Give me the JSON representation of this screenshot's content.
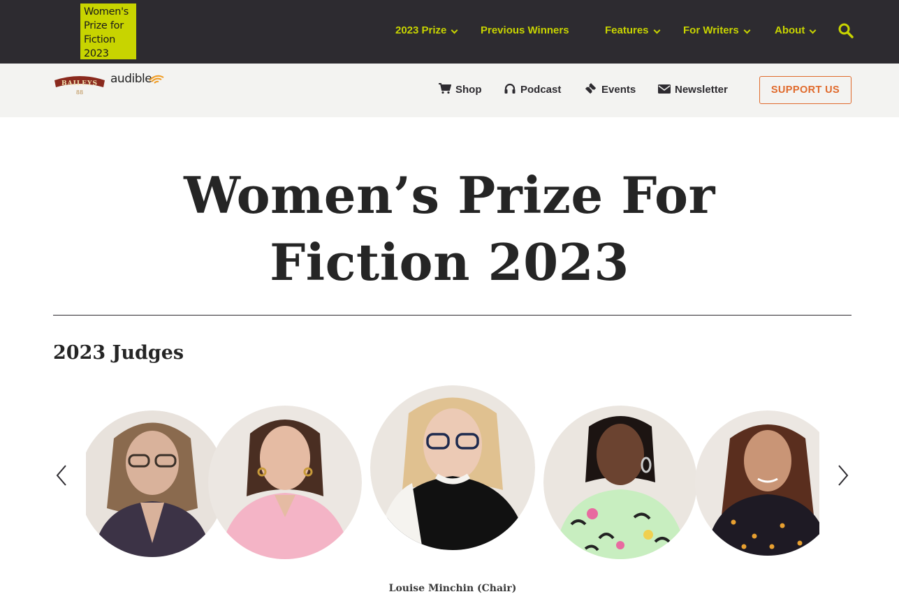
{
  "logo": {
    "lines": [
      "Women's",
      "Prize for",
      "Fiction",
      "2023"
    ],
    "color": "#c8d400"
  },
  "topnav": {
    "items": [
      {
        "label": "2023 Prize",
        "has_dropdown": true
      },
      {
        "label": "Previous Winners",
        "has_dropdown": false
      },
      {
        "label": "Features",
        "has_dropdown": true
      },
      {
        "label": "For Writers",
        "has_dropdown": true
      },
      {
        "label": "About",
        "has_dropdown": true
      }
    ],
    "search_icon": "search-icon"
  },
  "sponsors": {
    "baileys": "BAILEYS",
    "audible": "audible"
  },
  "subnav": {
    "items": [
      {
        "label": "Shop",
        "icon": "cart-icon"
      },
      {
        "label": "Podcast",
        "icon": "headphones-icon"
      },
      {
        "label": "Events",
        "icon": "ticket-icon"
      },
      {
        "label": "Newsletter",
        "icon": "envelope-icon"
      }
    ],
    "support_label": "SUPPORT US"
  },
  "main": {
    "title_line1": "Women’s Prize For",
    "title_line2": "Fiction 2023",
    "judges_heading": "2023 Judges",
    "active_caption": "Louise Minchin (Chair)"
  },
  "colors": {
    "dark": "#2d2b30",
    "accent": "#c8d400",
    "support": "#e06a2c",
    "subbar": "#f3f3f1"
  }
}
